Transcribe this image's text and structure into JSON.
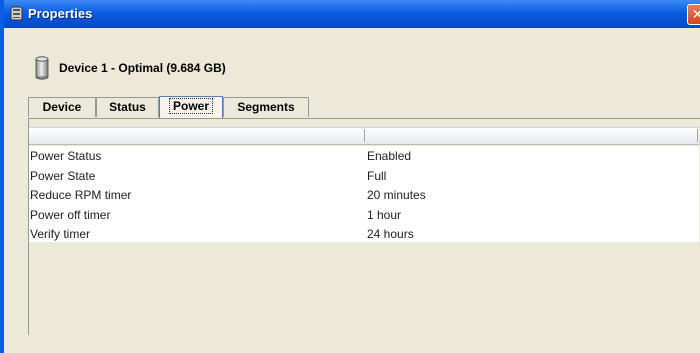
{
  "window": {
    "title": "Properties",
    "close_symbol": "✕"
  },
  "device": {
    "title": "Device 1 - Optimal (9.684 GB)",
    "icon": "disk-drive-icon"
  },
  "tabs": [
    {
      "label": "Device",
      "active": false
    },
    {
      "label": "Status",
      "active": false
    },
    {
      "label": "Power",
      "active": true
    },
    {
      "label": "Segments",
      "active": false
    }
  ],
  "table": {
    "columns": [
      "",
      ""
    ],
    "rows": [
      {
        "key": "Power Status",
        "value": "Enabled"
      },
      {
        "key": "Power State",
        "value": "Full"
      },
      {
        "key": "Reduce RPM timer",
        "value": "20 minutes"
      },
      {
        "key": "Power off timer",
        "value": "1 hour"
      },
      {
        "key": "Verify timer",
        "value": "24 hours"
      }
    ]
  },
  "colors": {
    "titlebar": "#0a5ce0",
    "window_bg": "#ece9d8",
    "close_button": "#d4461d"
  }
}
